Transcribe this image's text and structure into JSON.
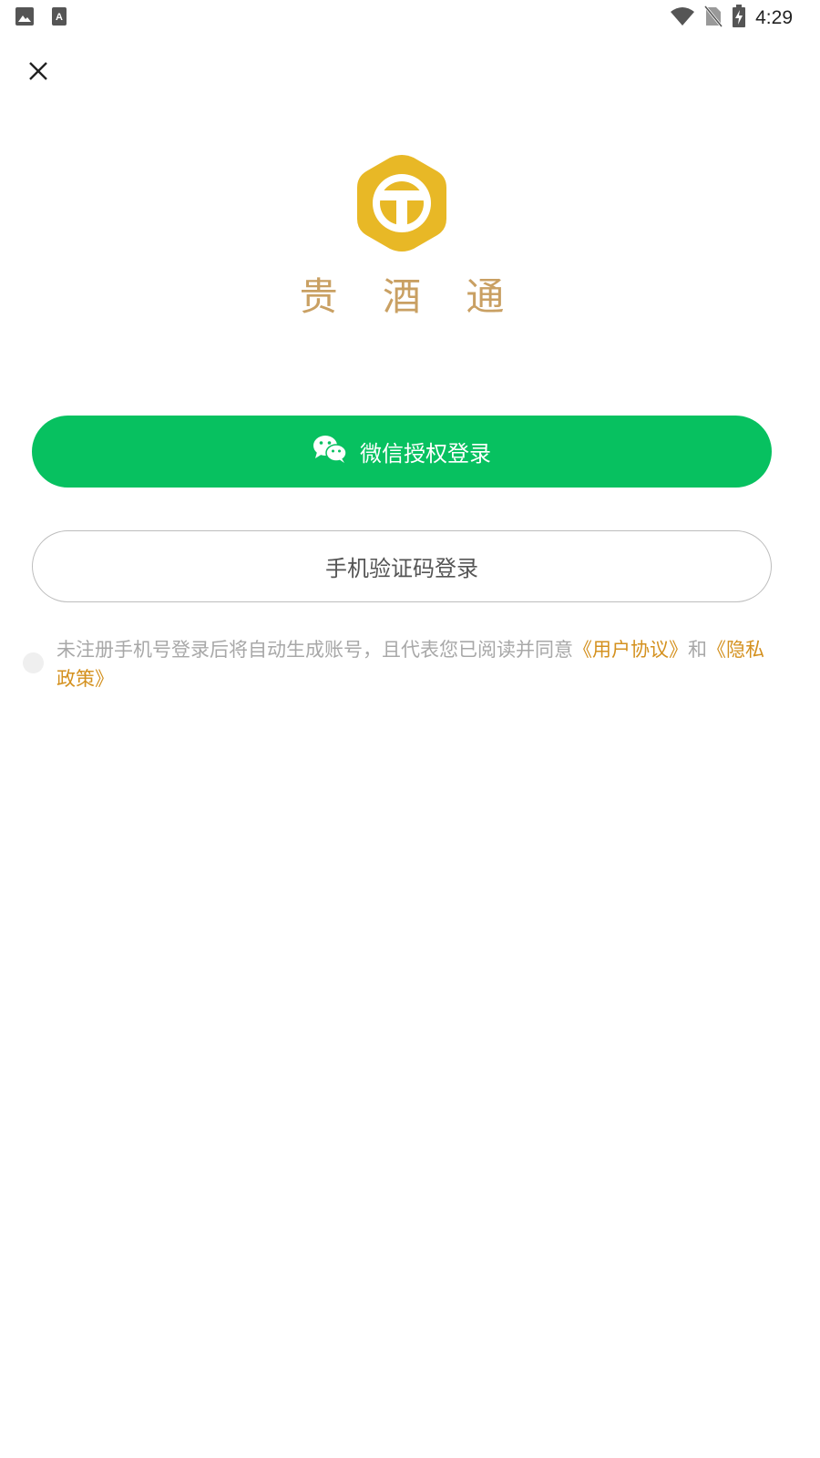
{
  "status_bar": {
    "time": "4:29",
    "left_icons": [
      "image-icon",
      "text-a-icon"
    ],
    "right_icons": [
      "wifi-icon",
      "no-sim-icon",
      "battery-charging-icon"
    ]
  },
  "brand": {
    "name": "贵 酒 通",
    "color": "#c9a063",
    "logo_color": "#e8b826"
  },
  "buttons": {
    "wechat_label": "微信授权登录",
    "wechat_color": "#07c160",
    "phone_label": "手机验证码登录"
  },
  "agreement": {
    "text": "未注册手机号登录后将自动生成账号，且代表您已阅读并同意",
    "user_agreement": "《用户协议》",
    "and": "和",
    "privacy_policy": "《隐私政策》",
    "link_color": "#d4911f"
  }
}
